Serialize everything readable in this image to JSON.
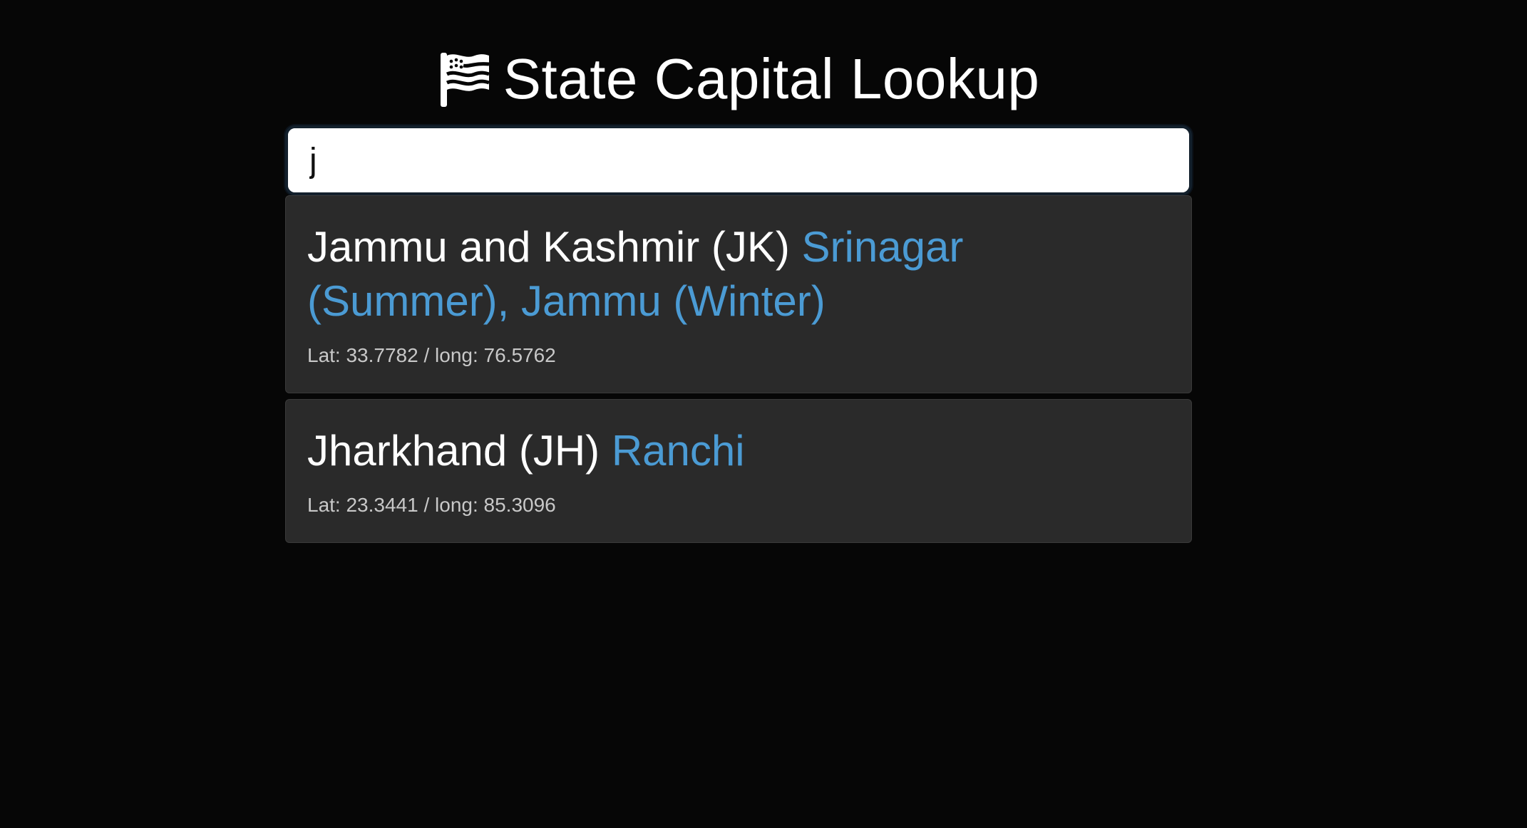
{
  "header": {
    "title": "State Capital Lookup",
    "icon": "flag-icon"
  },
  "search": {
    "value": "j",
    "placeholder": ""
  },
  "colors": {
    "background": "#060606",
    "card": "#2a2a2a",
    "capital": "#4b9bd4",
    "coords": "#c8c8c8"
  },
  "results": [
    {
      "state": "Jammu and Kashmir (JK)",
      "capital": "Srinagar (Summer), Jammu (Winter)",
      "coords": "Lat: 33.7782 / long: 76.5762"
    },
    {
      "state": "Jharkhand (JH)",
      "capital": "Ranchi",
      "coords": "Lat: 23.3441 / long: 85.3096"
    }
  ]
}
